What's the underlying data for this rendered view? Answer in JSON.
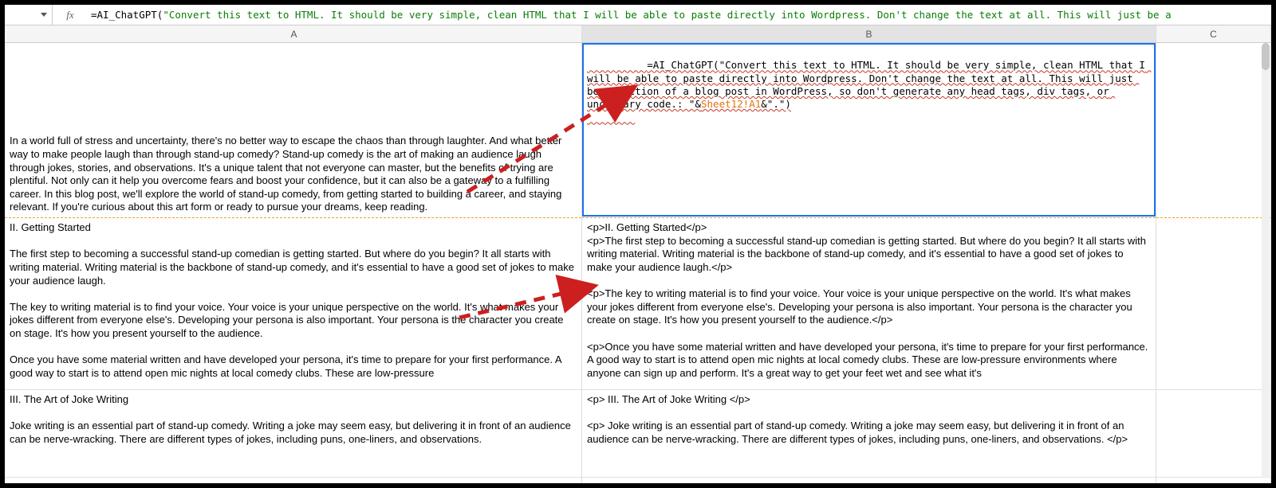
{
  "formula_bar": {
    "fx_label": "fx",
    "prefix": "=AI_ChatGPT(",
    "arg": "\"Convert this text to HTML. It should be very simple, clean HTML that I will be able to paste directly into Wordpress. Don't change the text at all. This will just be a"
  },
  "columns": {
    "A": "A",
    "B": "B",
    "C": "C"
  },
  "cells": {
    "A1": "In a world full of stress and uncertainty, there's no better way to escape the chaos than through laughter. And what better way to make people laugh than through stand-up comedy? Stand-up comedy is the art of making an audience laugh through jokes, stories, and observations. It's a unique talent that not everyone can master, but the benefits of trying are plentiful. Not only can it help you overcome fears and boost your confidence, but it can also be a gateway to a fulfilling career. In this blog post, we'll explore the world of stand-up comedy, from getting started to building a career, and staying relevant. If you're curious about this art form or ready to pursue your dreams, keep reading.",
    "A2": "II. Getting Started\n\nThe first step to becoming a successful stand-up comedian is getting started. But where do you begin? It all starts with writing material. Writing material is the backbone of stand-up comedy, and it's essential to have a good set of jokes to make your audience laugh.\n\nThe key to writing material is to find your voice. Your voice is your unique perspective on the world. It's what makes your jokes different from everyone else's. Developing your persona is also important. Your persona is the character you create on stage. It's how you present yourself to the audience.\n\nOnce you have some material written and have developed your persona, it's time to prepare for your first performance. A good way to start is to attend open mic nights at local comedy clubs. These are low-pressure",
    "A3": "III. The Art of Joke Writing\n\nJoke writing is an essential part of stand-up comedy. Writing a joke may seem easy, but delivering it in front of an audience can be nerve-wracking. There are different types of jokes, including puns, one-liners, and observations.",
    "B1_formula_prefix": "=AI_ChatGPT(",
    "B1_formula_arg": "\"Convert this text to HTML. It should be very simple, clean HTML that I will be able to paste directly into Wordpress. Don't change the text at all. This will just be a section of a blog post in WordPress, so don't generate any head tags, div tags, or uncessary code.: \"&",
    "B1_formula_ref": "Sheet12!A1",
    "B1_formula_suffix": "&\".\")",
    "B2": "<p>II. Getting Started</p>\n<p>The first step to becoming a successful stand-up comedian is getting started. But where do you begin? It all starts with writing material. Writing material is the backbone of stand-up comedy, and it's essential to have a good set of jokes to make your audience laugh.</p>\n\n<p>The key to writing material is to find your voice. Your voice is your unique perspective on the world. It's what makes your jokes different from everyone else's. Developing your persona is also important. Your persona is the character you create on stage. It's how you present yourself to the audience.</p>\n\n<p>Once you have some material written and have developed your persona, it's time to prepare for your first performance. A good way to start is to attend open mic nights at local comedy clubs. These are low-pressure environments where anyone can sign up and perform. It's a great way to get your feet wet and see what it's",
    "B3": "<p> III. The Art of Joke Writing </p>\n\n<p> Joke writing is an essential part of stand-up comedy. Writing a joke may seem easy, but delivering it in front of an audience can be nerve-wracking. There are different types of jokes, including puns, one-liners, and observations. </p>"
  }
}
